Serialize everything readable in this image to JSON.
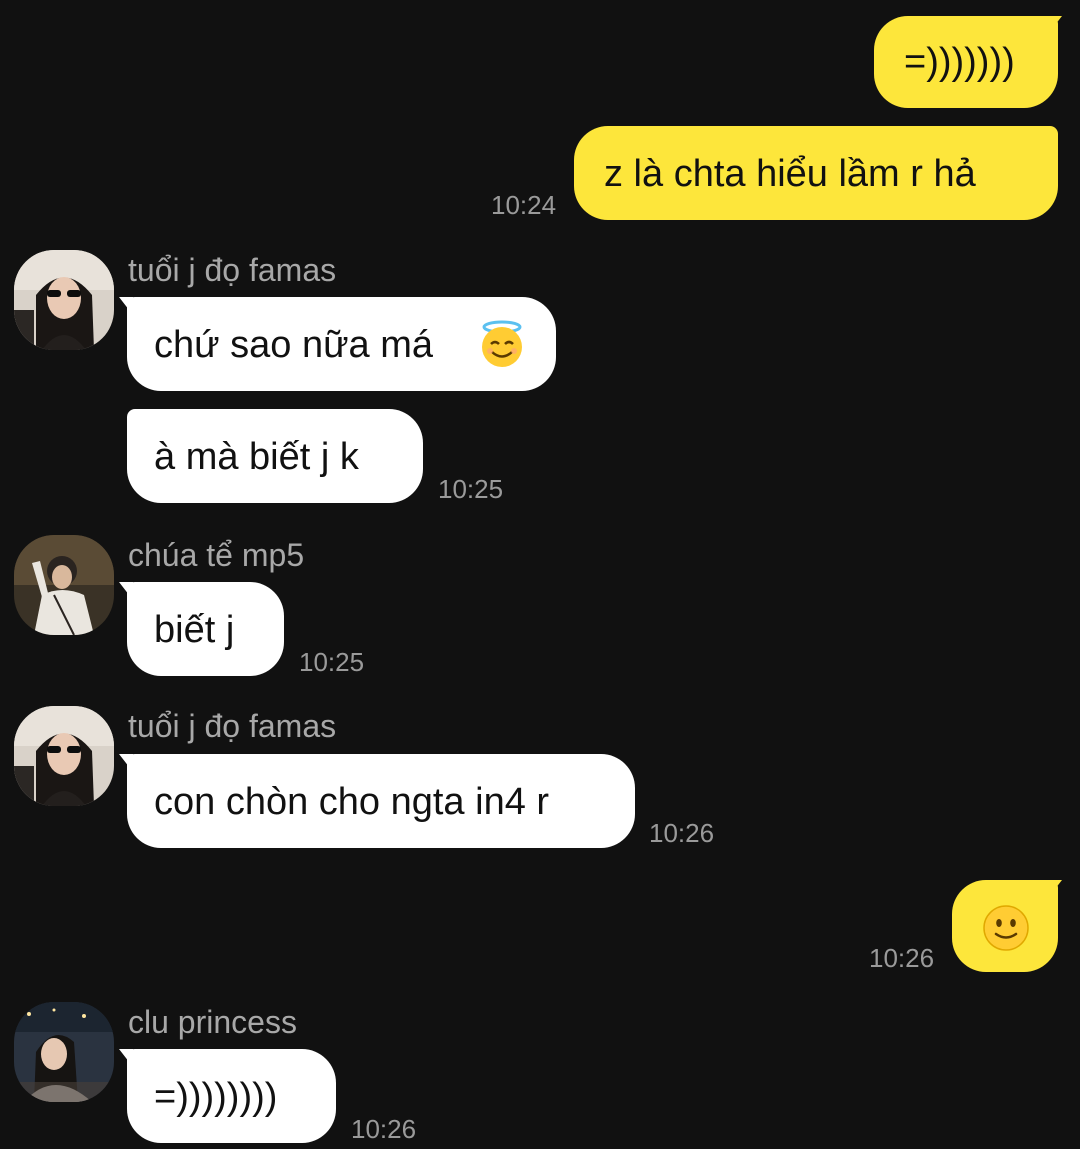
{
  "messages": [
    {
      "kind": "out",
      "text": "=)))))))",
      "time": ""
    },
    {
      "kind": "out",
      "text": "z là chta hiểu lầm r hả",
      "time": "10:24"
    },
    {
      "kind": "in",
      "sender": "tuổi j đọ famas",
      "text": "chứ sao nữa má",
      "emoji": "smiling-face-with-halo-icon",
      "time": ""
    },
    {
      "kind": "in",
      "text": "à mà biết j k",
      "time": "10:25"
    },
    {
      "kind": "in",
      "sender": "chúa tể mp5",
      "text": "biết j",
      "time": "10:25"
    },
    {
      "kind": "in",
      "sender": "tuổi j đọ famas",
      "text": "con chòn cho ngta in4 r",
      "time": "10:26"
    },
    {
      "kind": "out",
      "emoji": "slightly-smiling-face-icon",
      "time": "10:26"
    },
    {
      "kind": "in",
      "sender": "clu princess",
      "text": "=))))))))",
      "time": "10:26"
    }
  ],
  "colors": {
    "background": "#111111",
    "outgoing_bubble": "#fde63b",
    "incoming_bubble": "#ffffff",
    "timestamp": "#9a9a9a",
    "sender_name": "#a8a8a8"
  }
}
